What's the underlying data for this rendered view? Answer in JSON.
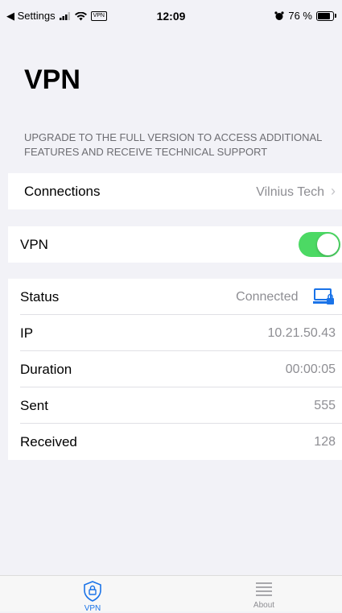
{
  "statusbar": {
    "back_label": "◀ Settings",
    "vpn_badge": "VPN",
    "time": "12:09",
    "battery": "76 %",
    "battery_level": 0.76
  },
  "page": {
    "title": "VPN",
    "upgrade_notice": "UPGRADE TO THE FULL VERSION TO ACCESS ADDITIONAL FEATURES AND RECEIVE TECHNICAL SUPPORT"
  },
  "connections": {
    "label": "Connections",
    "value": "Vilnius Tech"
  },
  "vpn_toggle": {
    "label": "VPN",
    "on": true,
    "color": "#4cd964"
  },
  "info": {
    "status": {
      "label": "Status",
      "value": "Connected"
    },
    "ip": {
      "label": "IP",
      "value": "10.21.50.43"
    },
    "duration": {
      "label": "Duration",
      "value": "00:00:05"
    },
    "sent": {
      "label": "Sent",
      "value": "555"
    },
    "received": {
      "label": "Received",
      "value": "128"
    }
  },
  "tabbar": {
    "tabs": [
      {
        "label": "VPN",
        "icon": "shield-lock-icon",
        "active": true,
        "color": "#1a73e8"
      },
      {
        "label": "About",
        "icon": "list-icon",
        "active": false,
        "color": "#8e8e93"
      }
    ]
  }
}
